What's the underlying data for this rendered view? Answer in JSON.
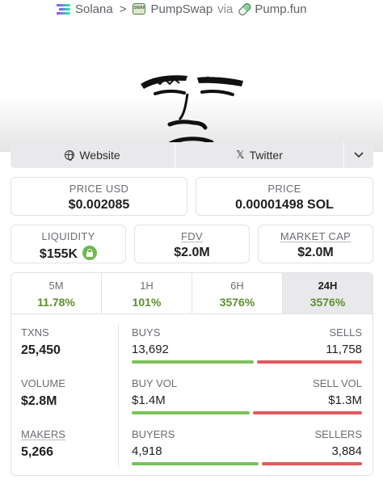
{
  "breadcrumb": {
    "chain": "Solana",
    "separator": ">",
    "dex": "PumpSwap",
    "via": "via",
    "launchpad": "Pump.fun"
  },
  "links": {
    "website": "Website",
    "twitter": "Twitter"
  },
  "price": {
    "usd_label": "PRICE USD",
    "usd_value": "$0.002085",
    "sol_label": "PRICE",
    "sol_value": "0.00001498 SOL"
  },
  "metrics": {
    "liquidity_label": "LIQUIDITY",
    "liquidity_value": "$155K",
    "fdv_label": "FDV",
    "fdv_value": "$2.0M",
    "mcap_label": "MARKET CAP",
    "mcap_value": "$2.0M"
  },
  "timeframes": [
    {
      "label": "5M",
      "value": "11.78%"
    },
    {
      "label": "1H",
      "value": "101%"
    },
    {
      "label": "6H",
      "value": "3576%"
    },
    {
      "label": "24H",
      "value": "3576%"
    }
  ],
  "stats": {
    "txns_label": "TXNS",
    "txns_value": "25,450",
    "volume_label": "VOLUME",
    "volume_value": "$2.8M",
    "makers_label": "MAKERS",
    "makers_value": "5,266"
  },
  "rows": {
    "buys_label": "BUYS",
    "buys_value": "13,692",
    "sells_label": "SELLS",
    "sells_value": "11,758",
    "buyvol_label": "BUY VOL",
    "buyvol_value": "$1.4M",
    "sellvol_label": "SELL VOL",
    "sellvol_value": "$1.3M",
    "buyers_label": "BUYERS",
    "buyers_value": "4,918",
    "sellers_label": "SELLERS",
    "sellers_value": "3,884"
  },
  "ratios": {
    "buys_fraction": 0.538,
    "buy_vol_fraction": 0.52,
    "buyers_fraction": 0.559
  },
  "colors": {
    "positive": "#5d8f2e",
    "buy_bar": "#7cc15a",
    "sell_bar": "#e05a5e",
    "active_tab_bg": "#e9e9eb"
  },
  "icons": {
    "chain": "solana-icon",
    "dex": "pumpswap-icon",
    "launchpad": "pill-icon",
    "website": "globe-icon",
    "twitter": "x-icon",
    "more": "chevron-down-icon",
    "liquidity": "lock-icon"
  }
}
